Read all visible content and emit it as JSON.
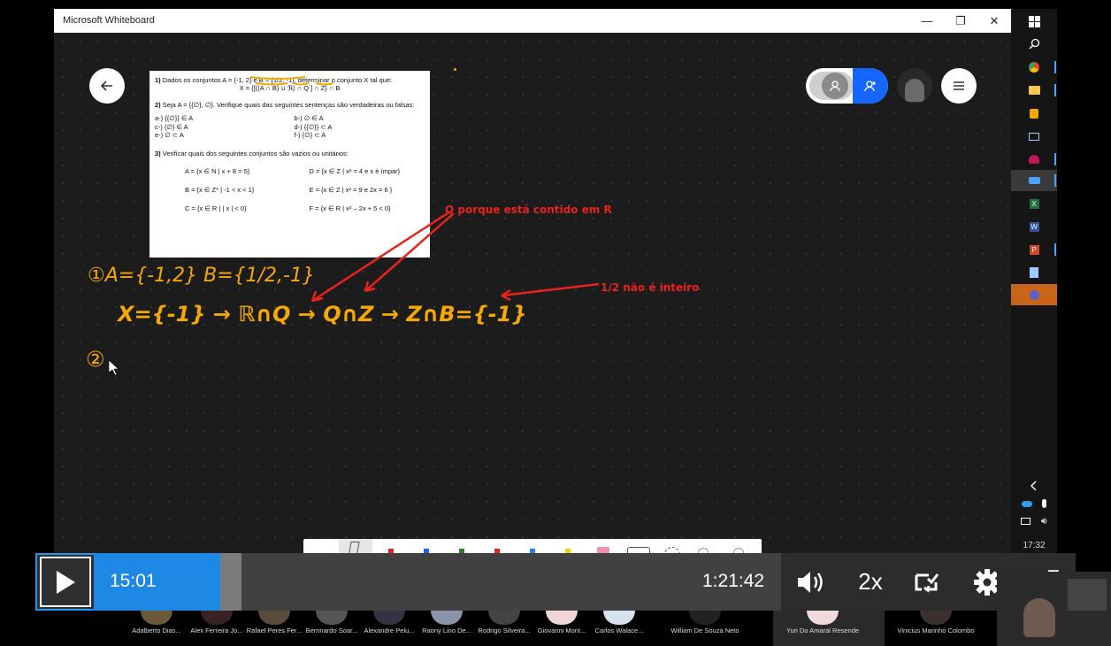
{
  "window": {
    "title": "Microsoft Whiteboard",
    "minimize": "—",
    "maximize": "❐",
    "close": "✕"
  },
  "colors": {
    "ink_orange": "#f5a800",
    "ink_red": "#e8231e",
    "accent_blue": "#1e88e5",
    "user_blue": "#1565ff"
  },
  "exercise": {
    "q1_num": "1)",
    "q1_text": "Dados os conjuntos A = {-1, 2} e B = {1/2, -1}, determinar o conjunto X tal que:",
    "q1_formula": "X = {[((A ∩ B) ∪ ℜ) ∩ Q ] ∩ Z} ∩ B",
    "q2_num": "2)",
    "q2_text": "Seja A = {{∅}, ∅}. Verifique quais das seguintes sentenças são verdadeiras ou falsas:",
    "q2_items": [
      "a-) {{∅}} ∈ A",
      "b-) ∅ ∈ A",
      "c-) {∅} ∈ A",
      "d-) {{∅}} ⊂ A",
      "e-) ∅ ⊂ A",
      "f-) {∅} ⊂ A"
    ],
    "q3_num": "3)",
    "q3_text": "Verificar quais dos seguintes conjuntos são vazios ou unitários:",
    "q3_sets": [
      "A = {x ∈ N | x + 8 = 5}",
      "D = {x ∈ Z | x² = 4 e x é ímpar}",
      "B = {x ∈ Z* | -1 < x < 1}",
      "E = {x ∈ Z | x² = 9 e 2x = 6 }",
      "C = {x ∈ R | | x | < 0}",
      "F = {x ∈ R | x² – 2x + 5 < 0}"
    ]
  },
  "ink": {
    "line1": "①A={-1,2}  B={1/2,-1}",
    "line2": "X={-1} → ℝ∩Q → Q∩Z → Z∩B={-1}",
    "line3": "②",
    "note1": "Q porque está contido em R",
    "note2": "1/2 não é inteiro"
  },
  "player": {
    "current_time": "15:01",
    "total_time": "1:21:42",
    "speed": "2x",
    "progress_fraction": 0.184
  },
  "taskbar": {
    "clock": "17:32"
  },
  "participants": [
    "Adalberto Dias...",
    "Alex Ferreira Jo...",
    "Rafael Peres Fer...",
    "Bernnardo Soar...",
    "Alexandre Pelu...",
    "Raony Lino De...",
    "Rodrigo Silveira...",
    "Giovanni Mont...",
    "Carlos Walace...",
    "William De Souza Neto",
    "Yuri Do Amaral Resende",
    "Vinicius Marinho Colombo"
  ]
}
